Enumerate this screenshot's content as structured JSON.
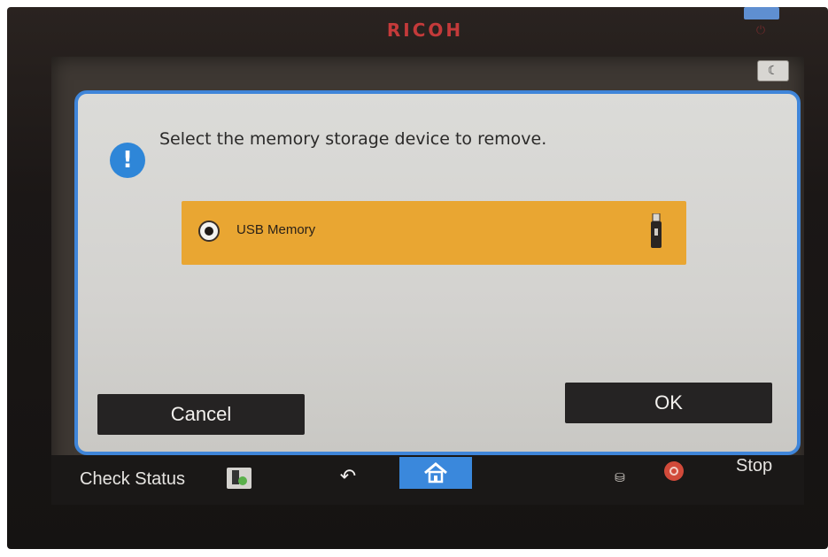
{
  "device": {
    "brand": "RICOH"
  },
  "dialog": {
    "message": "Select the memory storage device to remove.",
    "options": [
      {
        "label": "USB Memory",
        "selected": true
      }
    ],
    "cancel_label": "Cancel",
    "ok_label": "OK"
  },
  "bottom_bar": {
    "check_status_label": "Check Status",
    "stop_label": "Stop"
  },
  "colors": {
    "accent_blue": "#3f85d9",
    "option_highlight": "#e9a632",
    "stop_red": "#d14a3a"
  },
  "icons": [
    "alert-icon",
    "usb-drive-icon",
    "back-icon",
    "home-icon",
    "stop-icon",
    "moon-icon",
    "check-status-icon",
    "data-indicator-icon"
  ]
}
